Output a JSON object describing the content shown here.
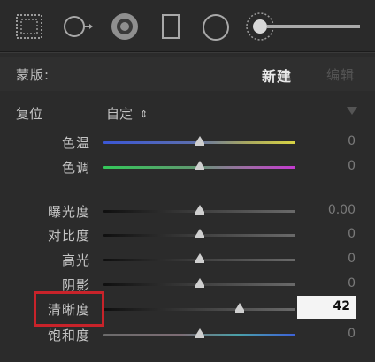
{
  "toolbar": {
    "tools": [
      {
        "name": "graduated-filter",
        "icon": "dotted-rect-icon"
      },
      {
        "name": "radial-filter",
        "icon": "circle-arrow-icon"
      },
      {
        "name": "red-eye",
        "icon": "radial-target-icon"
      },
      {
        "name": "rect-mask",
        "icon": "rectangle-icon"
      },
      {
        "name": "circle-mask",
        "icon": "circle-icon"
      },
      {
        "name": "adjustment-brush",
        "icon": "brush-size-slider-icon"
      }
    ]
  },
  "mask": {
    "label": "蒙版:",
    "new_label": "新建",
    "edit_label": "编辑"
  },
  "effect": {
    "reset_label": "复位",
    "preset_value": "自定",
    "preset_arrows": "⇕"
  },
  "sliders": [
    {
      "label": "色温",
      "value": "0",
      "fraction": 0.5,
      "track": "temp"
    },
    {
      "label": "色调",
      "value": "0",
      "fraction": 0.5,
      "track": "tint"
    },
    {
      "label": "曝光度",
      "value": "0.00",
      "fraction": 0.5,
      "track": "gray"
    },
    {
      "label": "对比度",
      "value": "0",
      "fraction": 0.5,
      "track": "gray"
    },
    {
      "label": "高光",
      "value": "0",
      "fraction": 0.5,
      "track": "gray"
    },
    {
      "label": "阴影",
      "value": "0",
      "fraction": 0.5,
      "track": "gray"
    },
    {
      "label": "清晰度",
      "value": "42",
      "fraction": 0.71,
      "track": "gray",
      "editing": true
    },
    {
      "label": "饱和度",
      "value": "0",
      "fraction": 0.5,
      "track": "sat"
    }
  ],
  "colors": {
    "highlight": "#c8232a",
    "background": "#2b2b2b"
  }
}
